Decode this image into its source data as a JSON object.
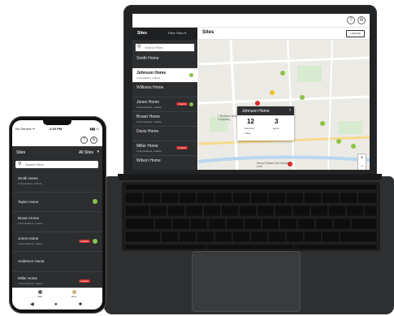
{
  "laptop": {
    "app_icons": [
      "help-icon",
      "gear-icon"
    ],
    "sidebar": {
      "title": "Sites",
      "filter": "Filter Sites ▾",
      "search_placeholder": "Search Sites",
      "items": [
        {
          "name": "Smith Home",
          "sub": "",
          "status": "none"
        },
        {
          "name": "Johnson Home",
          "sub": "1 Nomination, 2 alerts",
          "status": "ok",
          "active": true
        },
        {
          "name": "Williams Home",
          "sub": "",
          "status": "none"
        },
        {
          "name": "Jones Home",
          "sub": "2 Nominations, 2 alerts",
          "status": "alert",
          "badge": "2 alerts"
        },
        {
          "name": "Brown Home",
          "sub": "2 Nominations, 2 alerts",
          "status": "none"
        },
        {
          "name": "Davis Home",
          "sub": "",
          "status": "none"
        },
        {
          "name": "Miller Home",
          "sub": "2 Nominations, 2 alerts",
          "status": "alert",
          "badge": "2 alerts"
        },
        {
          "name": "Wilson Home",
          "sub": "",
          "status": "none"
        }
      ]
    },
    "main": {
      "title": "Sites",
      "add_button": "+ Add site",
      "map": {
        "labels": [
          "7 Brothers Moving Company",
          "Seven Peaks Fun Center Lehi"
        ],
        "popup": {
          "title": "Johnson Home",
          "close": "›",
          "count1": "12",
          "label1": "Favorites",
          "count2": "3",
          "label2": "alerts",
          "footer": "+ Map"
        },
        "zoom": [
          "+",
          "−"
        ]
      }
    }
  },
  "phone": {
    "status": {
      "carrier": "No Service ᯤ",
      "time": "2:20 PM",
      "battery": "▮▮▮ ▭"
    },
    "app_icons": [
      "help-icon",
      "gear-icon"
    ],
    "bar": {
      "title": "Sites",
      "filter": "All Sites",
      "chevron": "▾"
    },
    "search_placeholder": "Search Sites",
    "items": [
      {
        "name": "Smith Home",
        "sub": "1 Nomination, 2 alerts",
        "status": "none"
      },
      {
        "name": "Taylor Home",
        "sub": "",
        "status": "ok"
      },
      {
        "name": "Brown Home",
        "sub": "2 Nominations, 2 alerts",
        "status": "none"
      },
      {
        "name": "Jones Home",
        "sub": "2 Nominations, 2 alerts",
        "status": "alert",
        "badge": "2 alerts"
      },
      {
        "name": "Anderson Home",
        "sub": "",
        "status": "none"
      },
      {
        "name": "Miller Home",
        "sub": "2 Nominations, 2 alerts",
        "status": "alert",
        "badge": "2 alerts"
      }
    ],
    "nav": [
      {
        "label": "Map"
      },
      {
        "label": "Sites",
        "active": true
      }
    ],
    "system_nav": [
      "◀",
      "●",
      "■"
    ]
  },
  "colors": {
    "dark": "#2c2e30",
    "ok": "#8bc34a",
    "alert": "#d32f2f",
    "map": "#eceae4"
  }
}
